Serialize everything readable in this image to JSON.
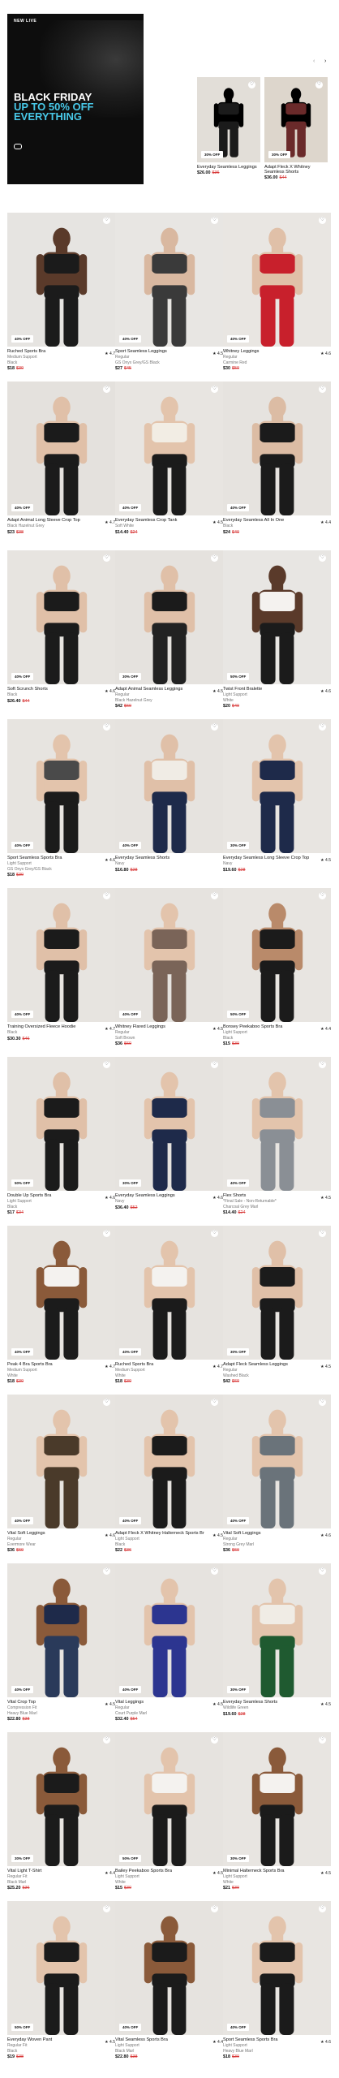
{
  "hero": {
    "badge": "NEW LIVE",
    "line1": "BLACK FRIDAY",
    "line2": "UP TO 50% OFF",
    "line3": "EVERYTHING",
    "meta": [
      "",
      "",
      ""
    ]
  },
  "carousel": {
    "prev": "‹",
    "next": "›",
    "items": [
      {
        "name": "Everyday Seamless Leggings",
        "price": "$26.00",
        "was": "$36",
        "disc": "30% OFF",
        "bg": "#e2ded8",
        "top": "#1b1b1b",
        "bottom": "#1b1b1b"
      },
      {
        "name": "Adapt Fleck X Whitney",
        "name2": "Seamless Shorts",
        "price": "$36.00",
        "was": "$44",
        "disc": "30% OFF",
        "bg": "#ddd6cc",
        "top": "#6a2a2a",
        "bottom": "#6a2a2a"
      }
    ]
  },
  "products": [
    {
      "name": "Ruched Sports Bra",
      "rating": "★ 4.7",
      "sub1": "Medium Support",
      "sub2": "Black",
      "price": "$18",
      "was": "$30",
      "disc": "40% OFF",
      "bg": "#e6e4e1",
      "top": "#1b1b1b",
      "bottom": "#1b1b1b",
      "skin": "#5a3a2a"
    },
    {
      "name": "Sport Seamless Leggings",
      "rating": "★ 4.5",
      "sub1": "Regular",
      "sub2": "GS Onyx Grey/GS Black",
      "price": "$27",
      "was": "$45",
      "disc": "40% OFF",
      "bg": "#e8e6e3",
      "top": "#3a3a3a",
      "bottom": "#3a3a3a",
      "skin": "#d9b8a0"
    },
    {
      "name": "Whitney Leggings",
      "rating": "★ 4.6",
      "sub1": "Regular",
      "sub2": "Carmine Red",
      "price": "$30",
      "was": "$50",
      "disc": "40% OFF",
      "bg": "#e9e6e2",
      "top": "#c8202c",
      "bottom": "#c8202c",
      "skin": "#e0c0a8"
    },
    {
      "name": "Adapt Animal Long Sleeve Crop Top",
      "rating": "★ 4.7",
      "sub1": "Black Hazelnut Grey",
      "sub2": "",
      "price": "$23",
      "was": "$38",
      "disc": "40% OFF",
      "bg": "#e4e1dd",
      "top": "#1b1b1b",
      "bottom": "#1b1b1b",
      "skin": "#e0c0a8"
    },
    {
      "name": "Everyday Seamless Crop Tank",
      "rating": "★ 4.5",
      "sub1": "Soft White",
      "sub2": "",
      "price": "$14.40",
      "was": "$24",
      "disc": "40% OFF",
      "bg": "#e8e5e1",
      "top": "#f2ede4",
      "bottom": "#1b1b1b",
      "skin": "#e3c4ac"
    },
    {
      "name": "Everyday Seamless All In One",
      "rating": "★ 4.4",
      "sub1": "Black",
      "sub2": "",
      "price": "$24",
      "was": "$40",
      "disc": "40% OFF",
      "bg": "#e6e3df",
      "top": "#1b1b1b",
      "bottom": "#1b1b1b",
      "skin": "#dcbca4"
    },
    {
      "name": "Soft Scrunch Shorts",
      "rating": "★ 4.6",
      "sub1": "Black",
      "sub2": "",
      "price": "$26.40",
      "was": "$44",
      "disc": "40% OFF",
      "bg": "#e7e4e0",
      "top": "#1b1b1b",
      "bottom": "#1b1b1b",
      "skin": "#e0c0a8"
    },
    {
      "name": "Adapt Animal Seamless Leggings",
      "rating": "★ 4.5",
      "sub1": "Regular",
      "sub2": "Black Hazelnut Grey",
      "price": "$42",
      "was": "$60",
      "disc": "30% OFF",
      "bg": "#e5e2de",
      "top": "#1b1b1b",
      "bottom": "#222",
      "skin": "#e0c0a8"
    },
    {
      "name": "Twist Front Bralette",
      "rating": "★ 4.6",
      "sub1": "Light Support",
      "sub2": "White",
      "price": "$20",
      "was": "$40",
      "disc": "50% OFF",
      "bg": "#e8e6e3",
      "top": "#f4f2ef",
      "bottom": "#1b1b1b",
      "skin": "#5a3a2a"
    },
    {
      "name": "Sport Seamless Sports Bra",
      "rating": "★ 4.6",
      "sub1": "Light Support",
      "sub2": "GS Onyx Grey/GS Black",
      "price": "$18",
      "was": "$30",
      "disc": "40% OFF",
      "bg": "#e7e4e0",
      "top": "#4a4a4a",
      "bottom": "#1b1b1b",
      "skin": "#e3c4ac"
    },
    {
      "name": "Everyday Seamless Shorts",
      "rating": "",
      "sub1": "Navy",
      "sub2": "",
      "price": "$16.80",
      "was": "$28",
      "disc": "40% OFF",
      "bg": "#e6e3df",
      "top": "#f0ece5",
      "bottom": "#1e2a4a",
      "skin": "#e0c0a8"
    },
    {
      "name": "Everyday Seamless Long Sleeve Crop Top",
      "rating": "★ 4.5",
      "sub1": "Navy",
      "sub2": "",
      "price": "$19.60",
      "was": "$28",
      "disc": "30% OFF",
      "bg": "#e8e5e1",
      "top": "#1e2a4a",
      "bottom": "#1e2a4a",
      "skin": "#e3c4ac"
    },
    {
      "name": "Training Oversized Fleece Hoodie",
      "rating": "★ 4.7",
      "sub1": "Black",
      "sub2": "",
      "price": "$30.30",
      "was": "$46",
      "disc": "40% OFF",
      "bg": "#e7e4e0",
      "top": "#1b1b1b",
      "bottom": "#1b1b1b",
      "skin": "#e0c0a8"
    },
    {
      "name": "Whitney Flared Leggings",
      "rating": "★ 4.5",
      "sub1": "Regular",
      "sub2": "Soft Brown",
      "price": "$36",
      "was": "$60",
      "disc": "40% OFF",
      "bg": "#e6e3df",
      "top": "#7a6458",
      "bottom": "#7a6458",
      "skin": "#e3c4ac"
    },
    {
      "name": "Bonsey Peekaboo Sports Bra",
      "rating": "★ 4.4",
      "sub1": "Light Support",
      "sub2": "Black",
      "price": "$15",
      "was": "$30",
      "disc": "50% OFF",
      "bg": "#e8e5e1",
      "top": "#1b1b1b",
      "bottom": "#1b1b1b",
      "skin": "#b98a6a"
    },
    {
      "name": "Double Up Sports Bra",
      "rating": "★ 4.6",
      "sub1": "Light Support",
      "sub2": "Black",
      "price": "$17",
      "was": "$34",
      "disc": "50% OFF",
      "bg": "#e7e4e0",
      "top": "#1b1b1b",
      "bottom": "#1b1b1b",
      "skin": "#e0c0a8"
    },
    {
      "name": "Everyday Seamless Leggings",
      "rating": "★ 4.6",
      "sub1": "Navy",
      "sub2": "",
      "price": "$36.40",
      "was": "$52",
      "disc": "30% OFF",
      "bg": "#e6e3df",
      "top": "#1e2a4a",
      "bottom": "#1e2a4a",
      "skin": "#e3c4ac"
    },
    {
      "name": "Flex Shorts",
      "rating": "★ 4.5",
      "sub1": "*Final Sale - Non-Returnable*",
      "sub2": "Charcoal Grey Marl",
      "price": "$14.40",
      "was": "$24",
      "disc": "40% OFF",
      "bg": "#e8e5e1",
      "top": "#8a8f95",
      "bottom": "#8a8f95",
      "skin": "#e3c4ac"
    },
    {
      "name": "Peak 4 Bra Sports Bra",
      "rating": "★ 4.7",
      "sub1": "Medium Support",
      "sub2": "White",
      "price": "$18",
      "was": "$30",
      "disc": "40% OFF",
      "bg": "#e7e4e0",
      "top": "#f4f2ef",
      "bottom": "#1b1b1b",
      "skin": "#8a5a3a"
    },
    {
      "name": "Ruched Sports Bra",
      "rating": "★ 4.7",
      "sub1": "Medium Support",
      "sub2": "White",
      "price": "$18",
      "was": "$30",
      "disc": "40% OFF",
      "bg": "#e6e3df",
      "top": "#f4f2ef",
      "bottom": "#1b1b1b",
      "skin": "#e3c4ac"
    },
    {
      "name": "Adapt Fleck Seamless Leggings",
      "rating": "★ 4.5",
      "sub1": "Regular",
      "sub2": "Washed Black",
      "price": "$42",
      "was": "$60",
      "disc": "30% OFF",
      "bg": "#e8e5e1",
      "top": "#1b1b1b",
      "bottom": "#1b1b1b",
      "skin": "#e0c0a8"
    },
    {
      "name": "Vital Soft Leggings",
      "rating": "★ 4.6",
      "sub1": "Regular",
      "sub2": "Evermore Wear",
      "price": "$36",
      "was": "$60",
      "disc": "40% OFF",
      "bg": "#e7e4e0",
      "top": "#4a3a2a",
      "bottom": "#4a3a2a",
      "skin": "#e3c4ac"
    },
    {
      "name": "Adapt Fleck X Whitney Halterneck Sports Bra",
      "rating": "★ 4.5",
      "sub1": "Light Support",
      "sub2": "Black",
      "price": "$22",
      "was": "$36",
      "disc": "40% OFF",
      "bg": "#e6e3df",
      "top": "#1b1b1b",
      "bottom": "#1b1b1b",
      "skin": "#e3c4ac"
    },
    {
      "name": "Vital Soft Leggings",
      "rating": "★ 4.6",
      "sub1": "Regular",
      "sub2": "Strong Grey Marl",
      "price": "$36",
      "was": "$60",
      "disc": "40% OFF",
      "bg": "#e8e5e1",
      "top": "#6a737a",
      "bottom": "#6a737a",
      "skin": "#e3c4ac"
    },
    {
      "name": "Vital Crop Top",
      "rating": "★ 4.5",
      "sub1": "Compression Fit",
      "sub2": "Heavy Blue Marl",
      "price": "$22.80",
      "was": "$38",
      "disc": "40% OFF",
      "bg": "#e7e4e0",
      "top": "#1e2a4a",
      "bottom": "#2a3a5a",
      "skin": "#8a5a3a"
    },
    {
      "name": "Vital Leggings",
      "rating": "★ 4.5",
      "sub1": "Regular",
      "sub2": "Court Purple Marl",
      "price": "$32.40",
      "was": "$54",
      "disc": "40% OFF",
      "bg": "#e6e3df",
      "top": "#2c3590",
      "bottom": "#2c3590",
      "skin": "#e3c4ac"
    },
    {
      "name": "Everyday Seamless Shorts",
      "rating": "★ 4.5",
      "sub1": "Wildlife Green",
      "sub2": "",
      "price": "$19.60",
      "was": "$28",
      "disc": "30% OFF",
      "bg": "#e8e5e1",
      "top": "#f0ece5",
      "bottom": "#1f5a30",
      "skin": "#e3c4ac"
    },
    {
      "name": "Vital Light T-Shirt",
      "rating": "★ 4.4",
      "sub1": "Regular Fit",
      "sub2": "Black Marl",
      "price": "$25.20",
      "was": "$36",
      "disc": "30% OFF",
      "bg": "#e7e4e0",
      "top": "#1b1b1b",
      "bottom": "#1b1b1b",
      "skin": "#8a5a3a"
    },
    {
      "name": "Bailey Peekaboo Sports Bra",
      "rating": "★ 4.5",
      "sub1": "Light Support",
      "sub2": "White",
      "price": "$15",
      "was": "$30",
      "disc": "50% OFF",
      "bg": "#e6e3df",
      "top": "#f4f2ef",
      "bottom": "#1b1b1b",
      "skin": "#e3c4ac"
    },
    {
      "name": "Minimal Halterneck Sports Bra",
      "rating": "★ 4.5",
      "sub1": "Light Support",
      "sub2": "White",
      "price": "$21",
      "was": "$30",
      "disc": "30% OFF",
      "bg": "#e8e5e1",
      "top": "#f4f2ef",
      "bottom": "#1b1b1b",
      "skin": "#8a5a3a"
    },
    {
      "name": "Everyday Woven Pant",
      "rating": "★ 4.5",
      "sub1": "Regular Fit",
      "sub2": "Black",
      "price": "$19",
      "was": "$38",
      "disc": "50% OFF",
      "bg": "#e7e4e0",
      "top": "#1b1b1b",
      "bottom": "#1b1b1b",
      "skin": "#e3c4ac"
    },
    {
      "name": "Vital Seamless Sports Bra",
      "rating": "★ 4.4",
      "sub1": "Light Support",
      "sub2": "Black Marl",
      "price": "$22.80",
      "was": "$38",
      "disc": "40% OFF",
      "bg": "#e6e3df",
      "top": "#1b1b1b",
      "bottom": "#1b1b1b",
      "skin": "#8a5a3a"
    },
    {
      "name": "Sport Seamless Sports Bra",
      "rating": "★ 4.6",
      "sub1": "Light Support",
      "sub2": "Heavy Blue Marl",
      "price": "$18",
      "was": "$30",
      "disc": "40% OFF",
      "bg": "#e8e5e1",
      "top": "#1b1b1b",
      "bottom": "#1b1b1b",
      "skin": "#e3c4ac"
    }
  ],
  "icons": {
    "heart": "♡"
  }
}
